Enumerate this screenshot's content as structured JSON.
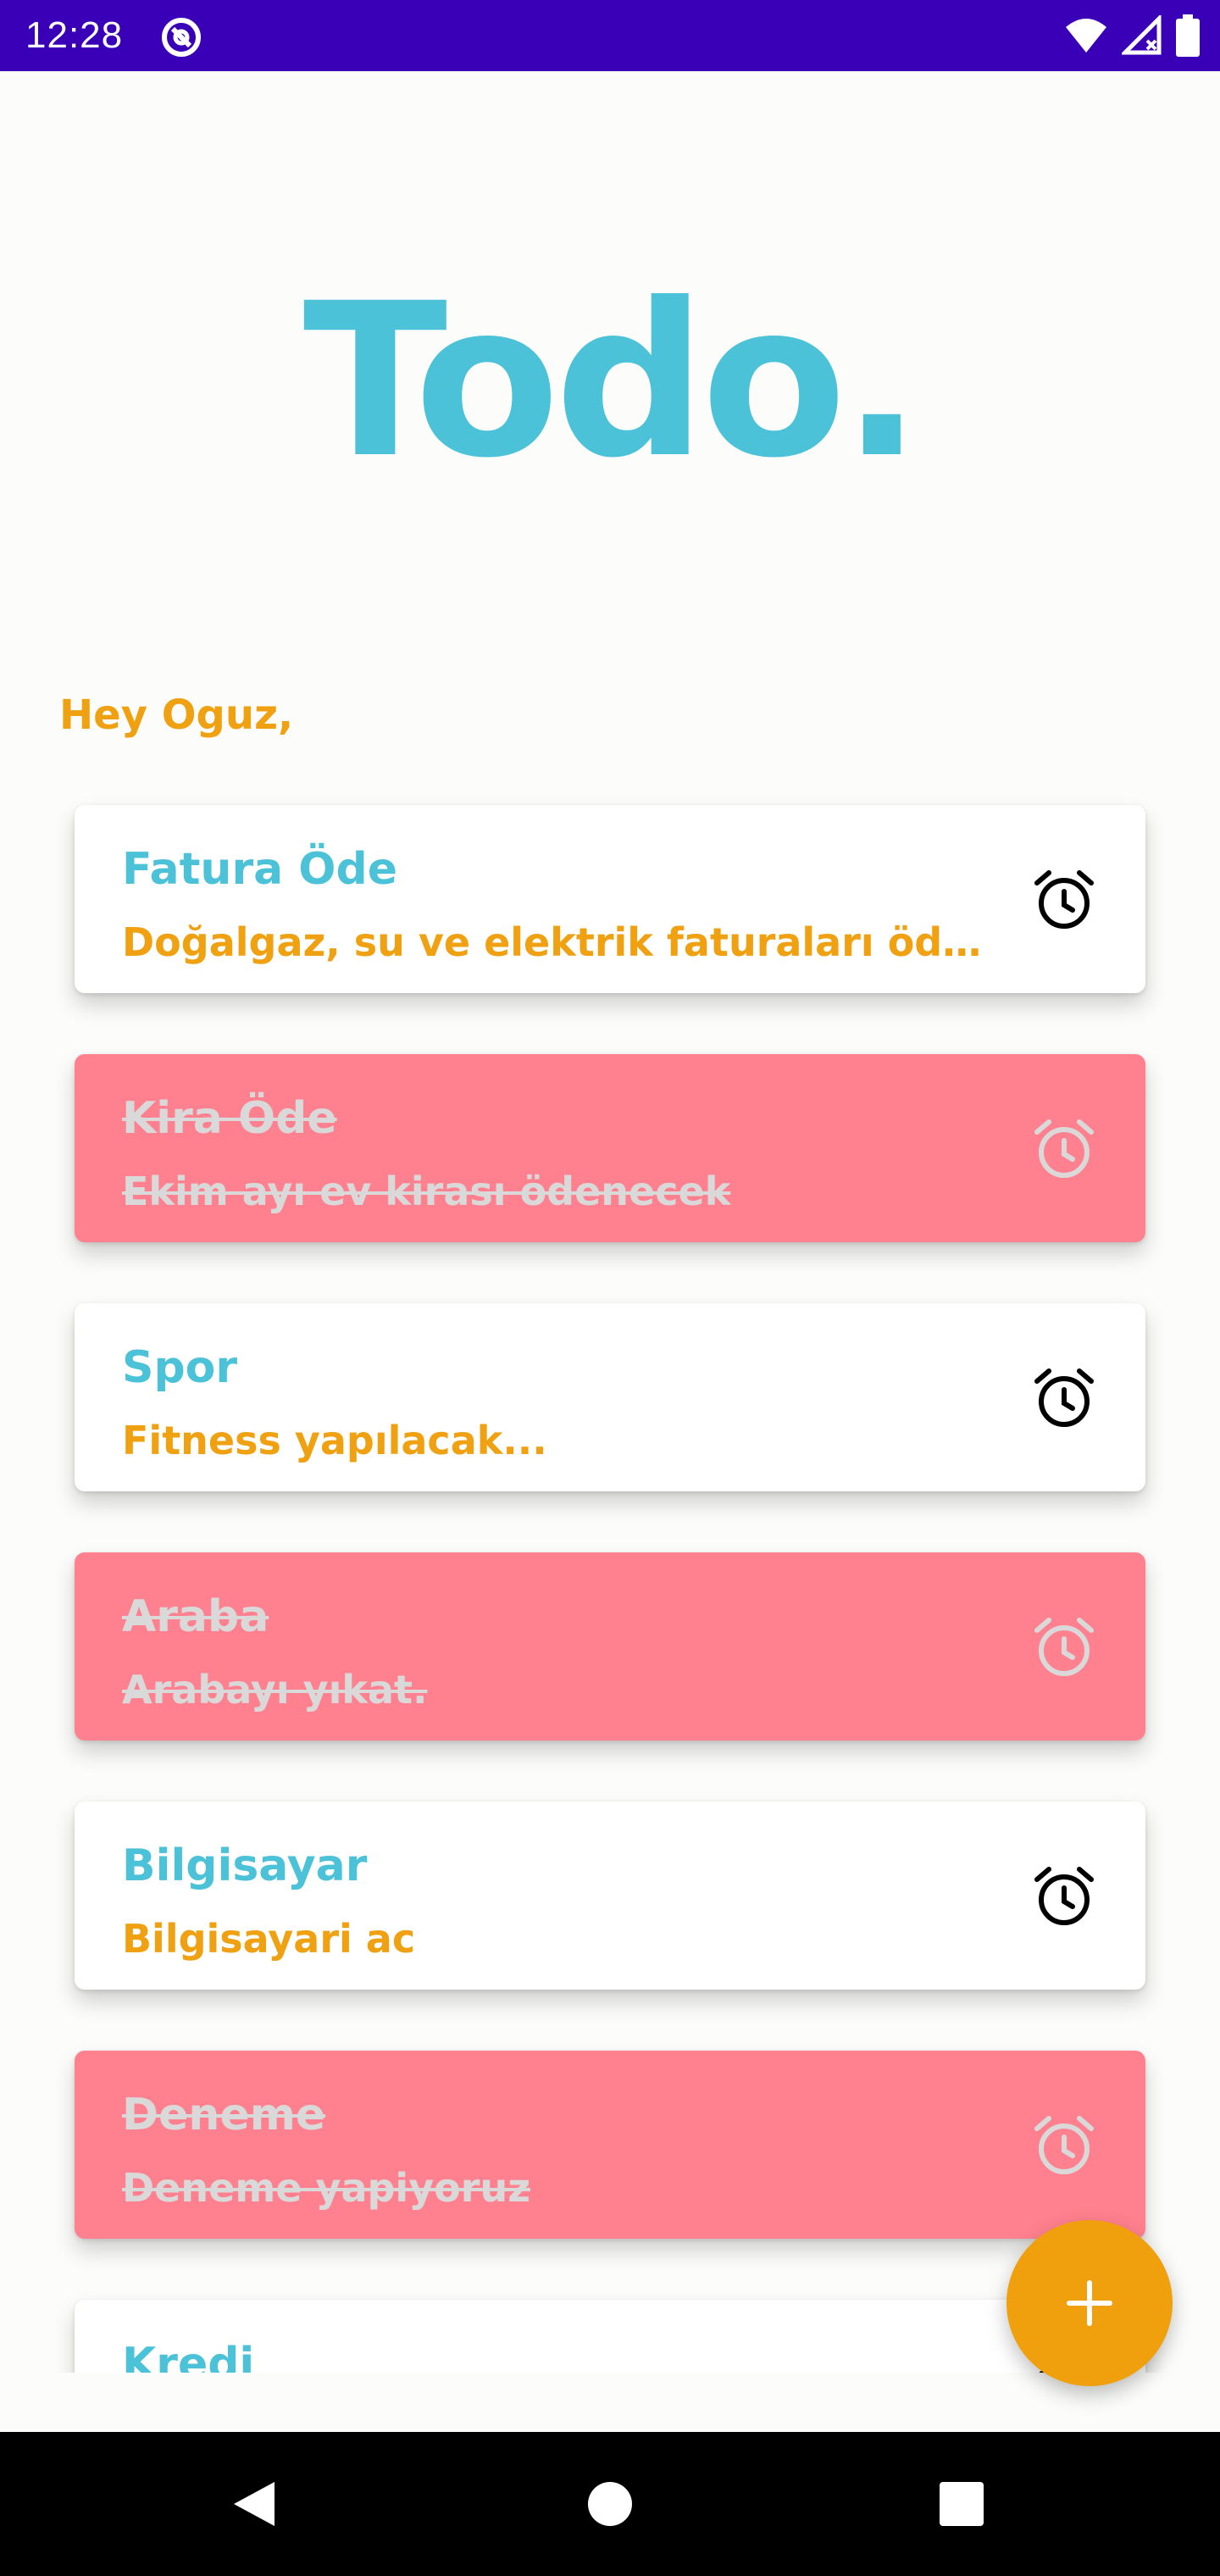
{
  "status_bar": {
    "time": "12:28",
    "icons": [
      "app-notification-icon",
      "wifi-icon",
      "cellular-signal-icon",
      "battery-icon"
    ]
  },
  "header": {
    "title": "Todo."
  },
  "greeting": "Hey Oguz,",
  "colors": {
    "title": "#4cc2d8",
    "accent": "#efa112",
    "done_card": "#ff808e",
    "fab": "#f0a00c",
    "status_bar": "#3a00b8"
  },
  "tasks": [
    {
      "title": "Fatura Öde",
      "description": "Doğalgaz, su ve elektrik faturaları öden...",
      "done": false,
      "icon": "alarm-icon"
    },
    {
      "title": "Kira Öde",
      "description": "Ekim ayı ev kirası ödenecek",
      "done": true,
      "icon": "alarm-icon"
    },
    {
      "title": "Spor",
      "description": "Fitness yapılacak...",
      "done": false,
      "icon": "alarm-icon"
    },
    {
      "title": "Araba",
      "description": "Arabayı yıkat.",
      "done": true,
      "icon": "alarm-icon"
    },
    {
      "title": "Bilgisayar",
      "description": "Bilgisayari ac",
      "done": false,
      "icon": "alarm-icon"
    },
    {
      "title": "Deneme",
      "description": "Deneme yapiyoruz",
      "done": true,
      "icon": "alarm-icon"
    },
    {
      "title": "Kredi",
      "description": "",
      "done": false,
      "icon": "alarm-icon"
    }
  ],
  "fab": {
    "icon": "plus-icon"
  },
  "nav": {
    "icons": [
      "back-icon",
      "home-icon",
      "recents-icon"
    ]
  }
}
